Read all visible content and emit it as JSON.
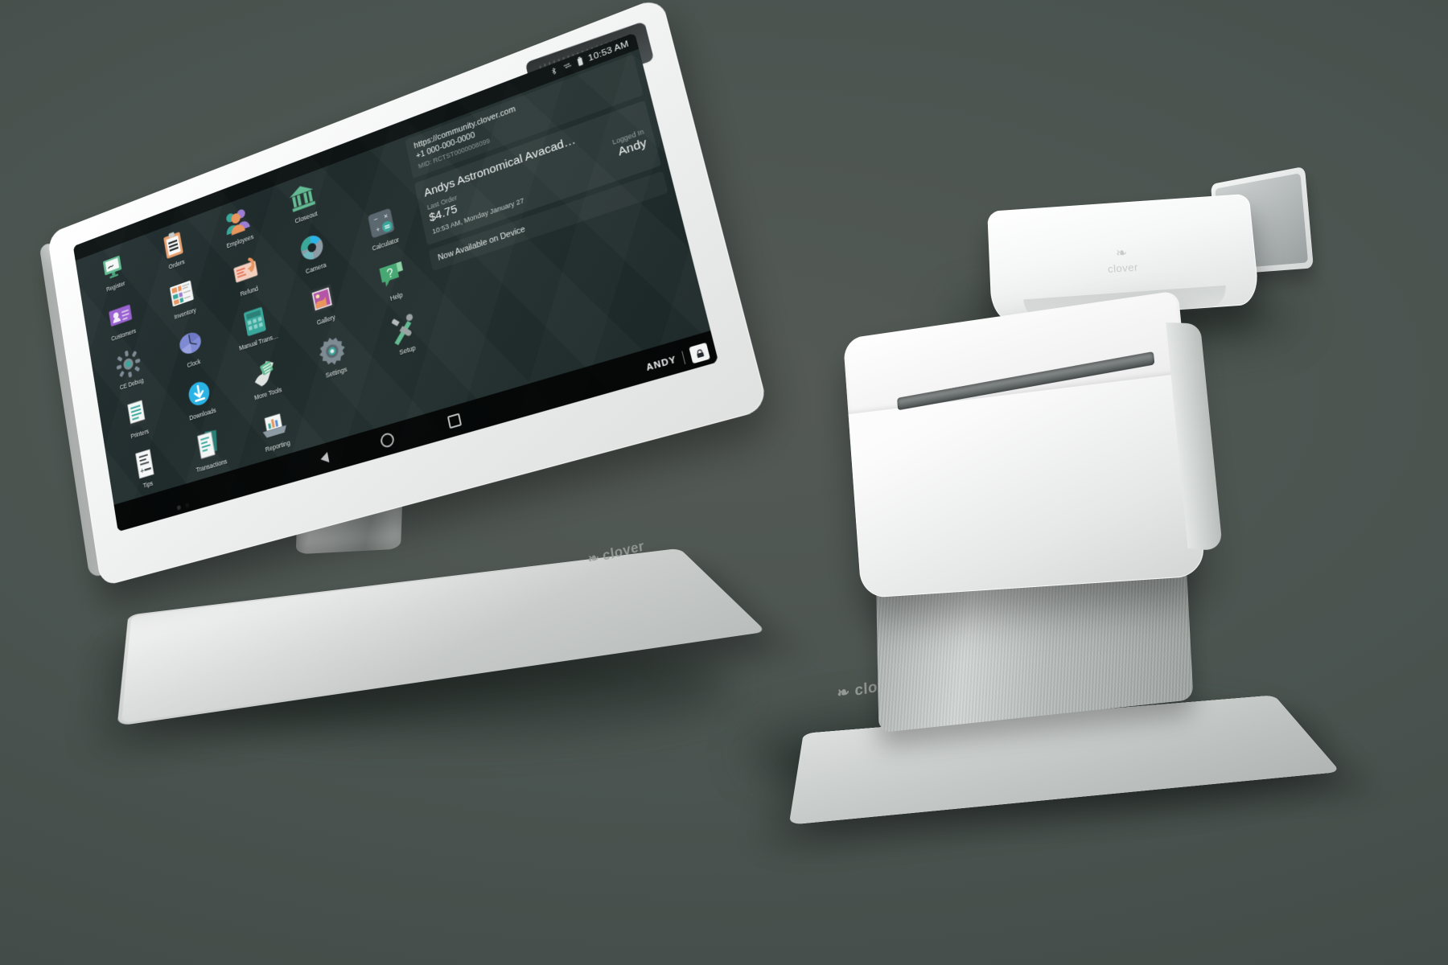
{
  "scene": {
    "title": "Clover POS system product photo",
    "background_color": "#4a5450"
  },
  "station": {
    "brand_label": "clover",
    "brand_mark": "❧",
    "status_bar": {
      "bluetooth_icon": "bluetooth-icon",
      "sync_icon": "sync-icon",
      "battery_icon": "battery-icon",
      "time": "10:53 AM"
    },
    "apps": [
      {
        "label": "Register",
        "icon": "register-icon"
      },
      {
        "label": "Orders",
        "icon": "orders-icon"
      },
      {
        "label": "Employees",
        "icon": "employees-icon"
      },
      {
        "label": "Closeout",
        "icon": "closeout-icon"
      },
      {
        "label": "",
        "icon": "spacer-icon"
      },
      {
        "label": "Customers",
        "icon": "customers-icon"
      },
      {
        "label": "Inventory",
        "icon": "inventory-icon"
      },
      {
        "label": "Refund",
        "icon": "refund-icon"
      },
      {
        "label": "Camera",
        "icon": "camera-icon"
      },
      {
        "label": "Calculator",
        "icon": "calculator-icon"
      },
      {
        "label": "CE Debug",
        "icon": "ce-debug-icon"
      },
      {
        "label": "Clock",
        "icon": "clock-icon"
      },
      {
        "label": "Manual Trans…",
        "icon": "manual-trans-icon"
      },
      {
        "label": "Gallery",
        "icon": "gallery-icon"
      },
      {
        "label": "Help",
        "icon": "help-icon"
      },
      {
        "label": "Printers",
        "icon": "printers-icon"
      },
      {
        "label": "Downloads",
        "icon": "downloads-icon"
      },
      {
        "label": "More Tools",
        "icon": "more-tools-icon"
      },
      {
        "label": "Settings",
        "icon": "settings-icon"
      },
      {
        "label": "Setup",
        "icon": "setup-icon"
      },
      {
        "label": "Tips",
        "icon": "tips-icon"
      },
      {
        "label": "Transactions",
        "icon": "transactions-icon"
      },
      {
        "label": "Reporting",
        "icon": "reporting-icon"
      }
    ],
    "page_dots": {
      "count": 2,
      "active_index": 0
    },
    "info_panel": {
      "url": "https://community.clover.com",
      "phone": "+1 000-000-0000",
      "mid": "MID: RCTST0000008099",
      "merchant_name": "Andys Astronomical Avacad…",
      "last_order_caption": "Last Order",
      "last_order_amount": "$4.75",
      "logged_in_caption": "Logged In",
      "logged_in_user": "Andy",
      "timestamp": "10:53 AM, Monday January 27",
      "available_banner": "Now Available on Device"
    },
    "nav_bar": {
      "back": "back-icon",
      "home": "home-icon",
      "recents": "recents-icon"
    },
    "user_strip": {
      "user": "ANDY",
      "lock": "lock-icon"
    }
  },
  "mini": {
    "brand_label": "clover",
    "brand_mark": "❧"
  },
  "printer": {
    "brand_label": "clover",
    "brand_mark": "❧"
  }
}
